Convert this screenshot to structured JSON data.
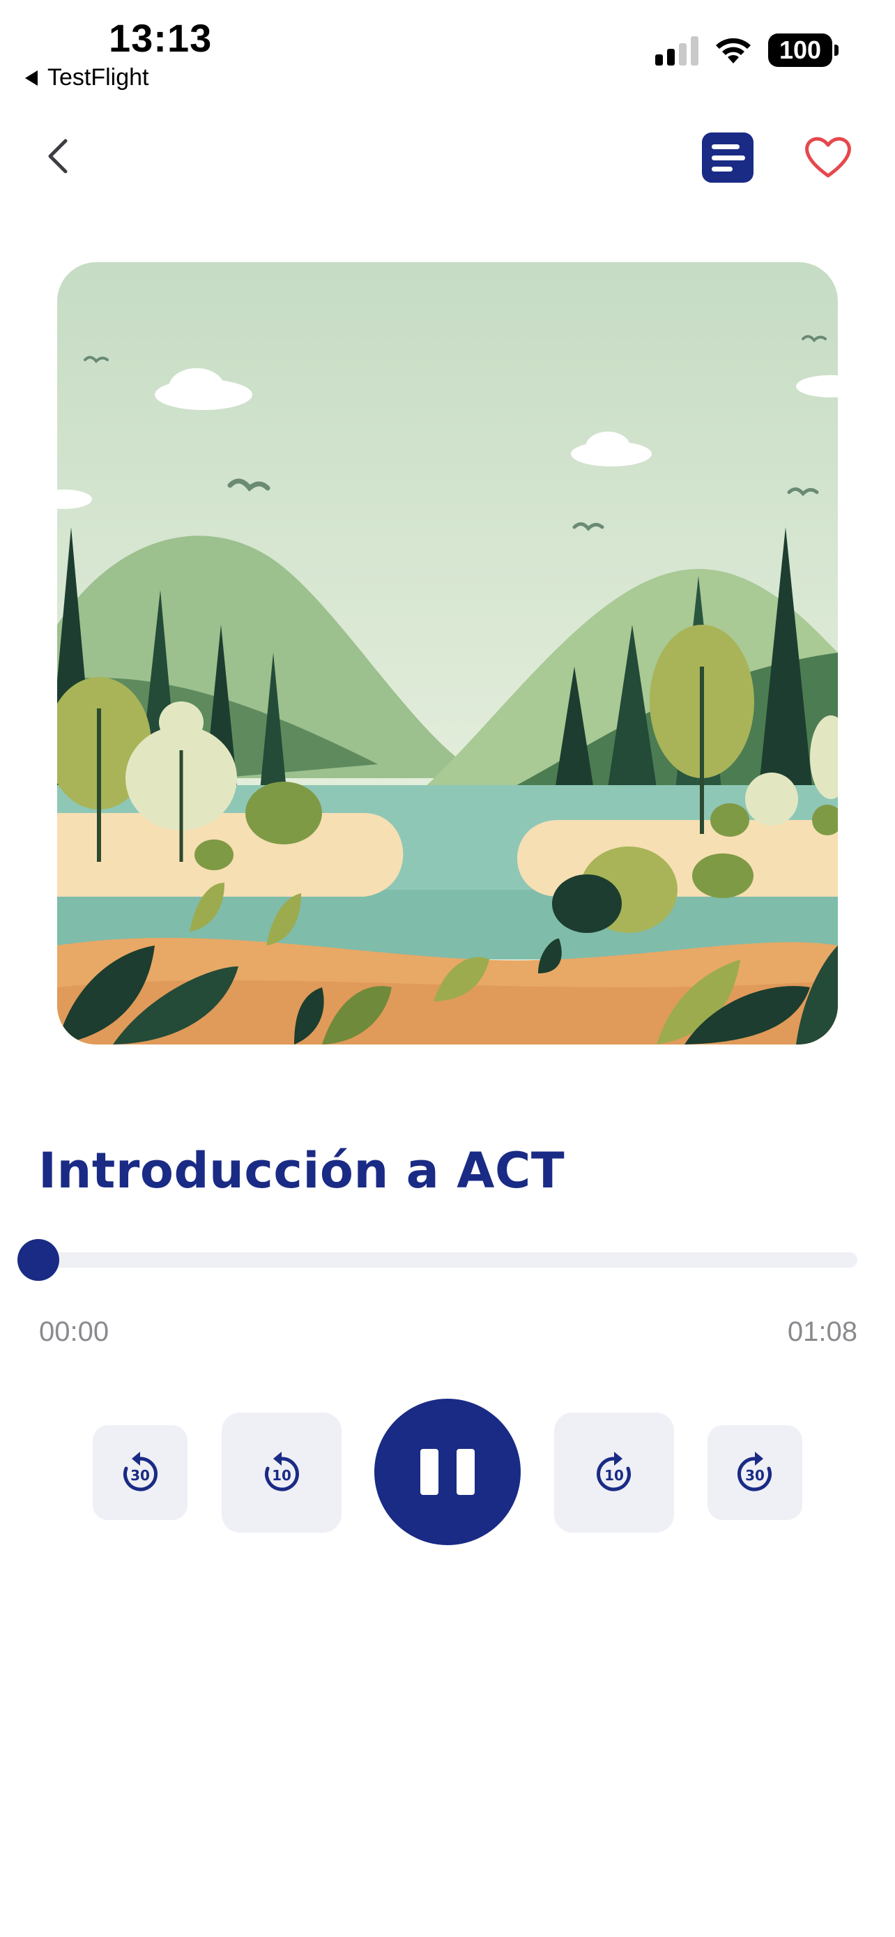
{
  "status_bar": {
    "time": "13:13",
    "back_app": "TestFlight",
    "battery": "100"
  },
  "header": {
    "back_icon": "chevron-left-icon",
    "transcript_icon": "text-lines-icon",
    "favorite_icon": "heart-outline-icon",
    "accent_color": "#1a2b85",
    "favorite_color": "#e5484d"
  },
  "track": {
    "title": "Introducción a ACT",
    "artwork": "forest-lake-illustration"
  },
  "progress": {
    "current": "00:00",
    "total": "01:08",
    "fraction": 0.0
  },
  "controls": {
    "rewind_30": {
      "icon": "rewind-30-icon",
      "label": "30"
    },
    "rewind_10": {
      "icon": "rewind-10-icon",
      "label": "10"
    },
    "play_pause": {
      "icon": "pause-icon",
      "state": "playing"
    },
    "forward_10": {
      "icon": "forward-10-icon",
      "label": "10"
    },
    "forward_30": {
      "icon": "forward-30-icon",
      "label": "30"
    }
  }
}
